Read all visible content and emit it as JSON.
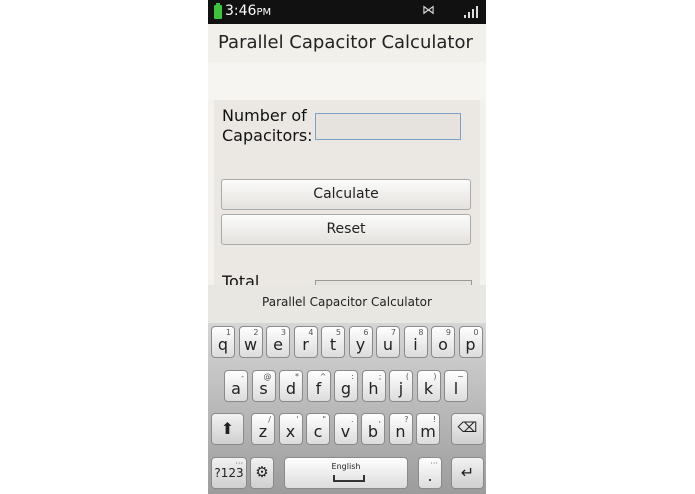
{
  "status": {
    "time": "3:46",
    "ampm": "PM"
  },
  "app": {
    "title": "Parallel Capacitor Calculator"
  },
  "form": {
    "num_label": "Number of Capacitors:",
    "calculate_label": "Calculate",
    "reset_label": "Reset",
    "total_label": "Total"
  },
  "suggestion": "Parallel Capacitor Calculator",
  "keyboard": {
    "row1": [
      {
        "k": "q",
        "s": "1"
      },
      {
        "k": "w",
        "s": "2"
      },
      {
        "k": "e",
        "s": "3"
      },
      {
        "k": "r",
        "s": "4"
      },
      {
        "k": "t",
        "s": "5"
      },
      {
        "k": "y",
        "s": "6"
      },
      {
        "k": "u",
        "s": "7"
      },
      {
        "k": "i",
        "s": "8"
      },
      {
        "k": "o",
        "s": "9"
      },
      {
        "k": "p",
        "s": "0"
      }
    ],
    "row2": [
      {
        "k": "a",
        "s": "-"
      },
      {
        "k": "s",
        "s": "@"
      },
      {
        "k": "d",
        "s": "*"
      },
      {
        "k": "f",
        "s": "^"
      },
      {
        "k": "g",
        "s": ":"
      },
      {
        "k": "h",
        "s": ";"
      },
      {
        "k": "j",
        "s": "("
      },
      {
        "k": "k",
        "s": ")"
      },
      {
        "k": "l",
        "s": "~"
      }
    ],
    "row3": [
      {
        "k": "z",
        "s": "/"
      },
      {
        "k": "x",
        "s": "'"
      },
      {
        "k": "c",
        "s": "\""
      },
      {
        "k": "v",
        "s": "."
      },
      {
        "k": "b",
        "s": ","
      },
      {
        "k": "n",
        "s": "?"
      },
      {
        "k": "m",
        "s": "!"
      }
    ],
    "sym_label": "?123",
    "space_label": "English",
    "period_label": "."
  }
}
